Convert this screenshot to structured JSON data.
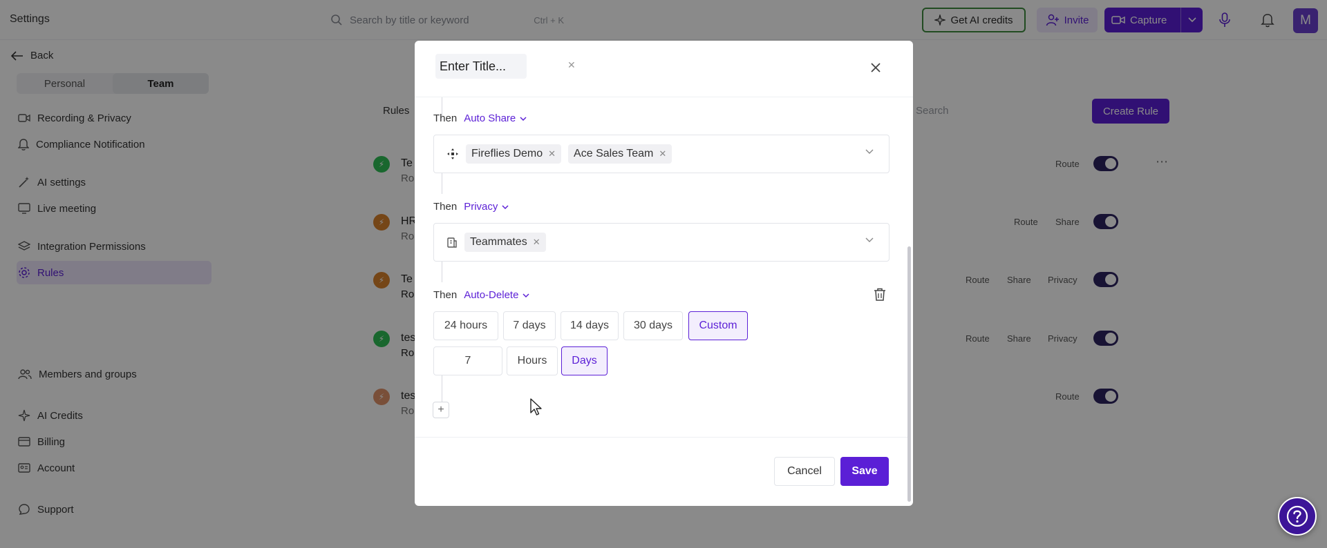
{
  "app": {
    "title": "Settings"
  },
  "search": {
    "placeholder": "Search by title or keyword",
    "shortcut": "Ctrl + K"
  },
  "topbar": {
    "credits_label": "Get AI credits",
    "invite_label": "Invite",
    "capture_label": "Capture",
    "avatar_initial": "M"
  },
  "sidebar": {
    "back_label": "Back",
    "segments": [
      "Personal",
      "Team"
    ],
    "active_segment": "Team",
    "items": [
      {
        "label": "Recording & Privacy",
        "icon": "video-icon"
      },
      {
        "label": "Compliance Notification",
        "icon": "bell-icon"
      },
      {
        "label": "AI settings",
        "icon": "magic-wand-icon"
      },
      {
        "label": "Live meeting",
        "icon": "monitor-icon"
      },
      {
        "label": "Integration Permissions",
        "icon": "layers-icon"
      },
      {
        "label": "Rules",
        "icon": "gear-icon",
        "active": true
      },
      {
        "label": "Members and groups",
        "icon": "users-icon"
      },
      {
        "label": "AI Credits",
        "icon": "sparkle-icon"
      },
      {
        "label": "Billing",
        "icon": "card-icon"
      },
      {
        "label": "Account",
        "icon": "id-card-icon"
      },
      {
        "label": "Support",
        "icon": "chat-icon"
      }
    ]
  },
  "rules_page": {
    "tab_label": "Rules",
    "search_placeholder": "Search",
    "create_label": "Create Rule",
    "rows": [
      {
        "name": "Te",
        "sub": "Ro",
        "color": "#2fbf55",
        "tags": [
          "Route"
        ],
        "more": "⋯"
      },
      {
        "name": "HR",
        "sub": "Ro",
        "color": "#d9822b",
        "tags": [
          "Route",
          "Share"
        ]
      },
      {
        "name": "Te",
        "sub": "Ro",
        "color": "#d9822b",
        "tags": [
          "Route",
          "Share",
          "Privacy"
        ]
      },
      {
        "name": "tes",
        "sub": "Ro",
        "color": "#2fbf55",
        "tags": [
          "Route",
          "Share",
          "Privacy"
        ]
      },
      {
        "name": "tes",
        "sub": "Ro",
        "color": "#e0936a",
        "tags": [
          "Route"
        ]
      }
    ]
  },
  "modal": {
    "title_placeholder": "Enter Title...",
    "steps": [
      {
        "then": "Then",
        "action": "Auto Share",
        "chips": [
          "Fireflies Demo",
          "Ace Sales Team"
        ],
        "icon": "share-icon"
      },
      {
        "then": "Then",
        "action": "Privacy",
        "chips": [
          "Teammates"
        ],
        "icon": "building-icon"
      },
      {
        "then": "Then",
        "action": "Auto-Delete"
      }
    ],
    "delete_options": [
      "24 hours",
      "7 days",
      "14 days",
      "30 days",
      "Custom"
    ],
    "selected_delete": "Custom",
    "custom_value": "7",
    "units": [
      "Hours",
      "Days"
    ],
    "selected_unit": "Days",
    "add_label": "+",
    "cancel_label": "Cancel",
    "save_label": "Save"
  },
  "colors": {
    "accent": "#5b1fd6",
    "credits_border": "#3d8b3d",
    "help": "#3c1598"
  }
}
